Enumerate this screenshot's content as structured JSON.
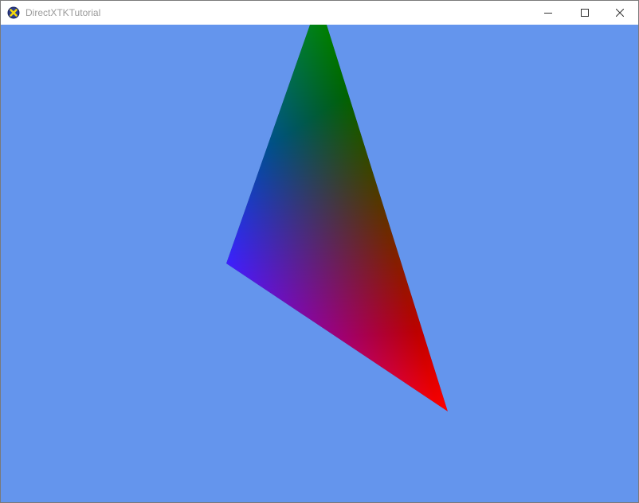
{
  "window": {
    "title": "DirectXTKTutorial",
    "icon": "directx-x-icon",
    "controls": [
      "minimize-icon",
      "maximize-icon",
      "close-icon"
    ]
  },
  "scene": {
    "clear_color": "#6495ed",
    "triangle": {
      "vertices": [
        {
          "name": "top",
          "color": "#008000"
        },
        {
          "name": "bottom-right",
          "color": "#ff0000"
        },
        {
          "name": "left",
          "color": "#0000ff"
        }
      ]
    }
  }
}
